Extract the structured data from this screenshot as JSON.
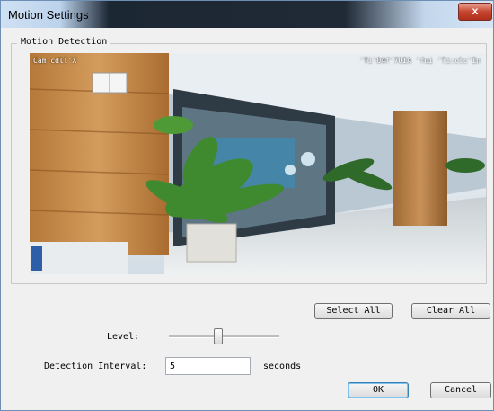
{
  "window": {
    "title": "Motion Settings",
    "close_label": "x"
  },
  "group": {
    "label": "Motion Detection"
  },
  "camera": {
    "osd_left": "Cam cdll'X",
    "osd_right": "'Ti'04f'7OIA 'fui 'Ti:clc'In"
  },
  "buttons": {
    "select_all": "Select All",
    "clear_all": "Clear All",
    "ok": "OK",
    "cancel": "Cancel"
  },
  "level": {
    "label": "Level:",
    "value_fraction": 0.45
  },
  "interval": {
    "label": "Detection Interval:",
    "value": "5",
    "unit": "seconds"
  },
  "colors": {
    "close_red": "#c7462f",
    "title_dark": "#1c2734"
  }
}
